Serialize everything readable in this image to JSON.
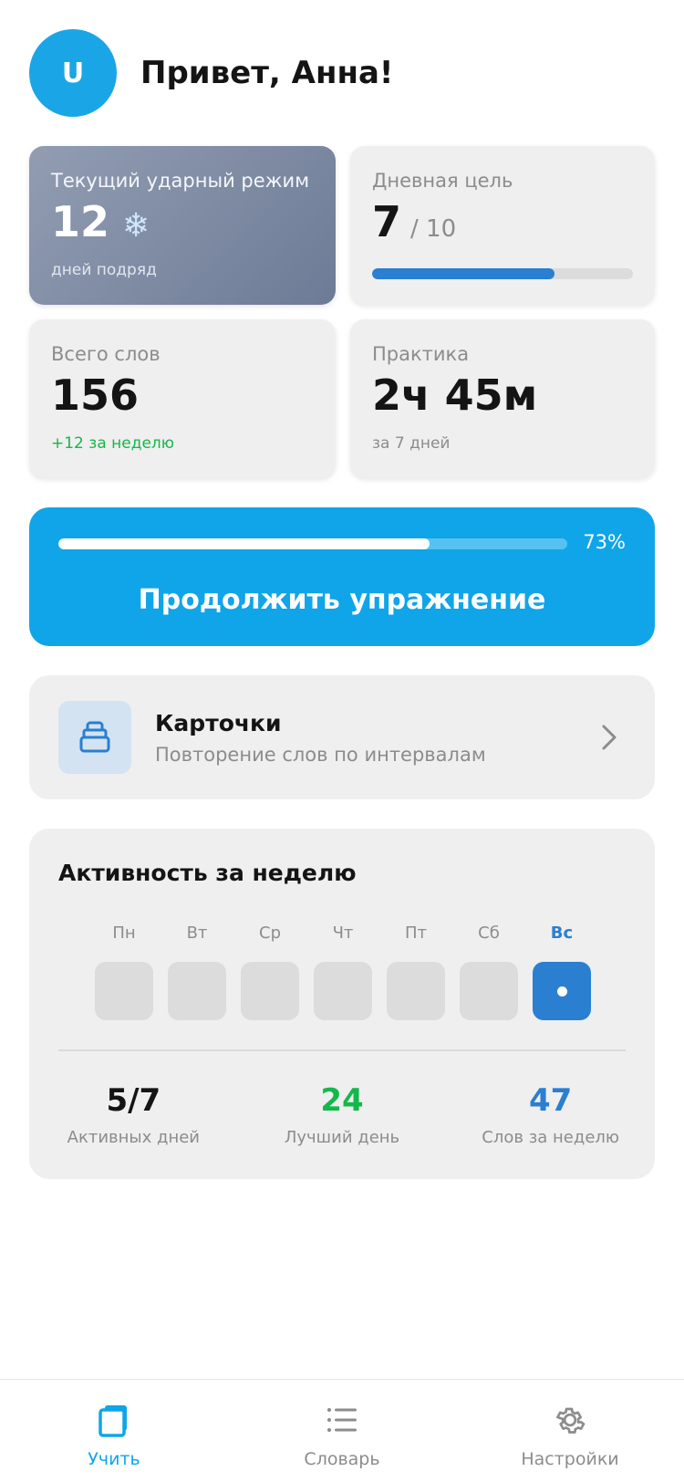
{
  "header": {
    "avatar_letter": "U",
    "greeting": "Привет, Анна!"
  },
  "streak": {
    "label": "Текущий ударный режим",
    "value": "12",
    "icon": "snowflake-icon",
    "sub": "дней подряд"
  },
  "daily_goal": {
    "label": "Дневная цель",
    "value": "7",
    "of": "/ 10",
    "progress": 0.7
  },
  "total_words": {
    "label": "Всего слов",
    "value": "156",
    "sub": "+12 за неделю"
  },
  "practice": {
    "label": "Практика",
    "value": "2ч 45м",
    "sub": "за 7 дней"
  },
  "continue": {
    "percent_label": "73%",
    "progress": 0.73,
    "label": "Продолжить упражнение"
  },
  "flashcards": {
    "title": "Карточки",
    "subtitle": "Повторение слов по интервалам",
    "icon": "cards-stack-icon"
  },
  "activity": {
    "title": "Активность за неделю",
    "days": [
      "Пн",
      "Вт",
      "Ср",
      "Чт",
      "Пт",
      "Сб",
      "Вс"
    ],
    "today_index": 6,
    "stats": [
      {
        "value": "5/7",
        "label": "Активных дней",
        "color": "#141414"
      },
      {
        "value": "24",
        "label": "Лучший день",
        "color": "#14b84a"
      },
      {
        "value": "47",
        "label": "Слов за неделю",
        "color": "#2a7fd0"
      }
    ]
  },
  "tabs": [
    {
      "label": "Учить",
      "icon": "learn-icon",
      "active": true
    },
    {
      "label": "Словарь",
      "icon": "list-icon",
      "active": false
    },
    {
      "label": "Настройки",
      "icon": "gear-icon",
      "active": false
    }
  ],
  "colors": {
    "accent": "#10a5e8",
    "blue": "#2a7fd0",
    "green": "#14b84a"
  }
}
